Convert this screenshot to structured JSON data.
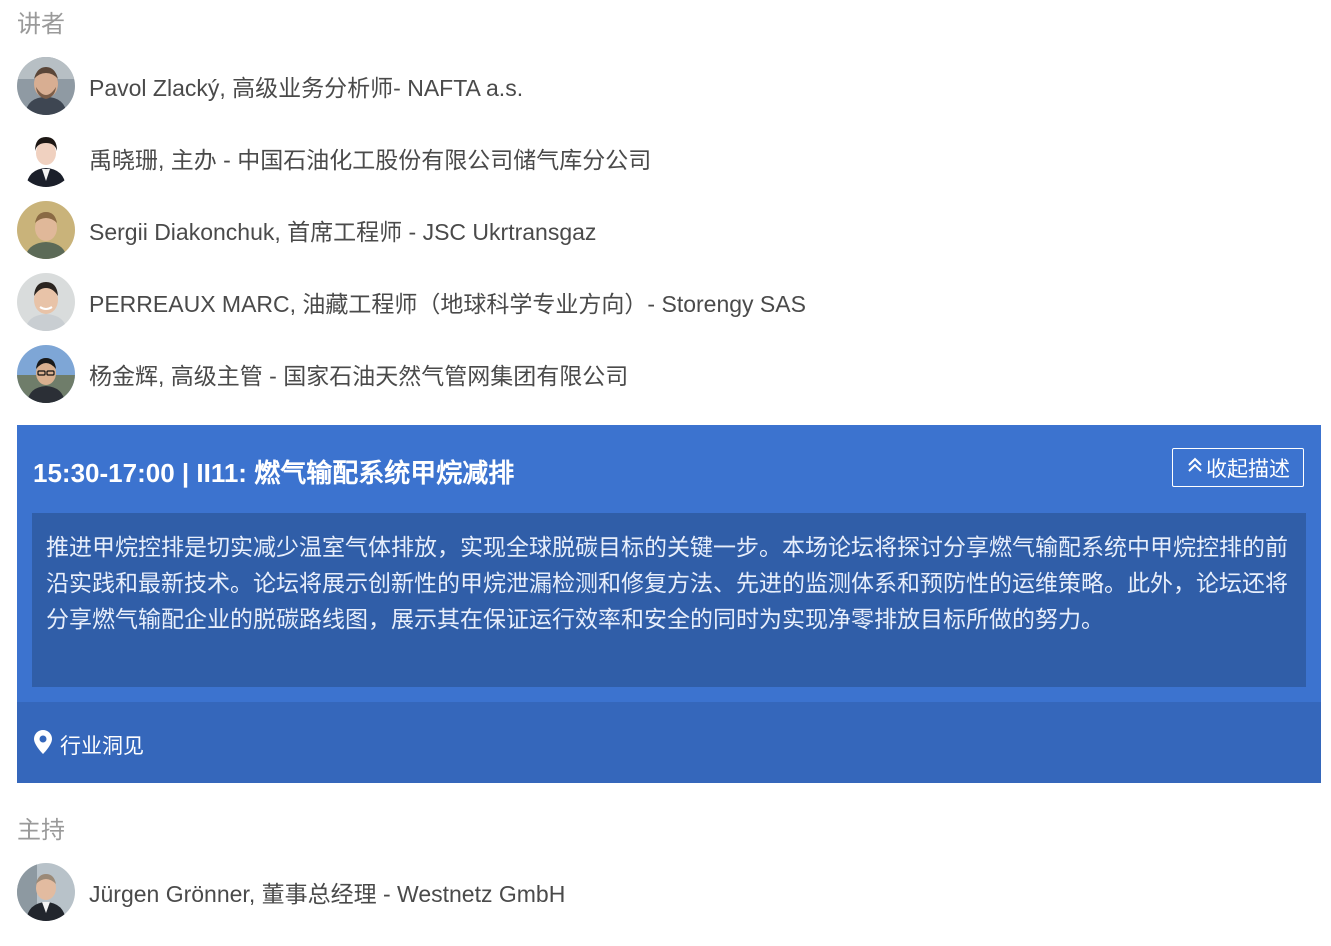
{
  "speakers_section": {
    "label": "讲者",
    "speakers": [
      {
        "text": "Pavol Zlacký, 高级业务分析师- NAFTA a.s."
      },
      {
        "text": "禹晓珊, 主办 - 中国石油化工股份有限公司储气库分公司"
      },
      {
        "text": "Sergii Diakonchuk, 首席工程师 - JSC Ukrtransgaz"
      },
      {
        "text": "PERREAUX MARC, 油藏工程师（地球科学专业方向）- Storengy SAS"
      },
      {
        "text": "杨金辉, 高级主管 - 国家石油天然气管网集团有限公司"
      }
    ]
  },
  "session": {
    "title": "15:30-17:00 | II11: 燃气输配系统甲烷减排",
    "collapse_label": "收起描述",
    "description": "推进甲烷控排是切实减少温室气体排放，实现全球脱碳目标的关键一步。本场论坛将探讨分享燃气输配系统中甲烷控排的前沿实践和最新技术。论坛将展示创新性的甲烷泄漏检测和修复方法、先进的监测体系和预防性的运维策略。此外，论坛还将分享燃气输配企业的脱碳路线图，展示其在保证运行效率和安全的同时为实现净零排放目标所做的努力。",
    "location": "行业洞见",
    "colors": {
      "background": "#3c73cf",
      "description_background": "#305ea8",
      "footer_background": "#3567bb"
    }
  },
  "moderator_section": {
    "label": "主持",
    "moderators": [
      {
        "text": "Jürgen Grönner, 董事总经理 - Westnetz GmbH"
      }
    ]
  }
}
